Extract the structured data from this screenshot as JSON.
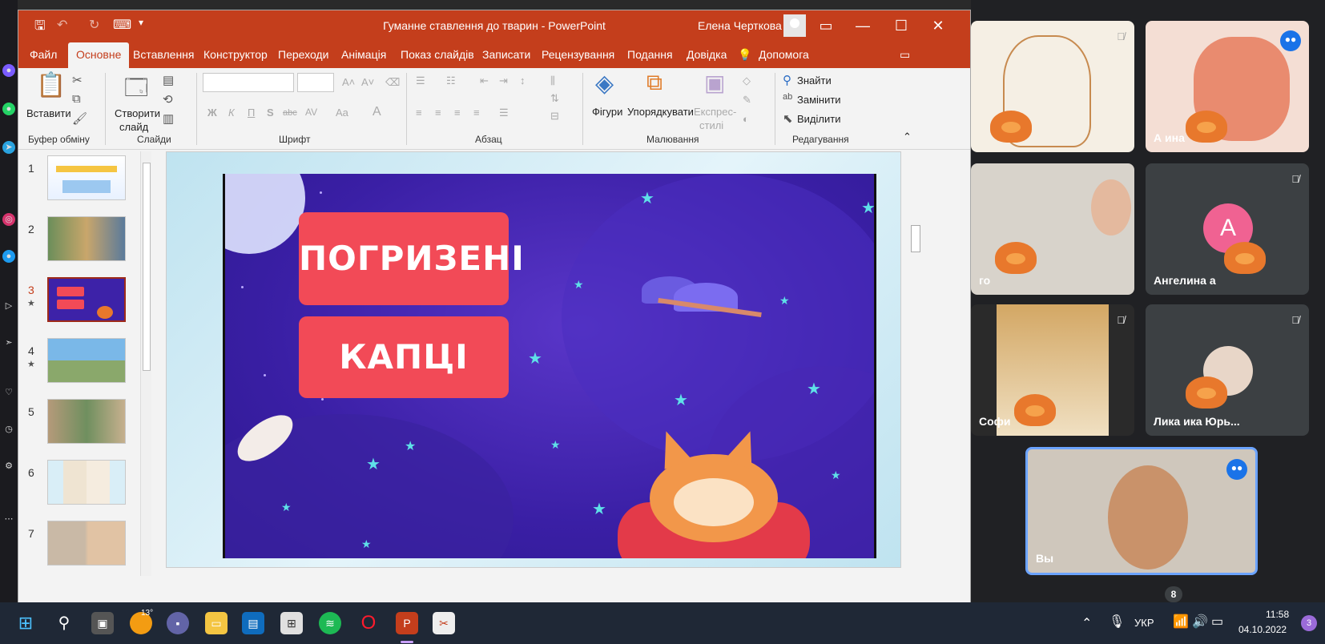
{
  "window": {
    "title": "Гуманне ставлення до тварин  -  PowerPoint",
    "user": "Елена Черткова"
  },
  "tabs": [
    "Файл",
    "Основне",
    "Вставлення",
    "Конструктор",
    "Переходи",
    "Анімація",
    "Показ слайдів",
    "Записати",
    "Рецензування",
    "Подання",
    "Довідка",
    "Допомога"
  ],
  "ribbon": {
    "paste": "Вставити",
    "create_slide_1": "Створити",
    "create_slide_2": "слайд",
    "figures": "Фігури",
    "arrange": "Упорядкувати",
    "styles_1": "Експрес-",
    "styles_2": "стилі",
    "find": "Знайти",
    "replace": "Замінити",
    "select": "Виділити",
    "groups": {
      "clipboard": "Буфер обміну",
      "slides": "Слайди",
      "font": "Шрифт",
      "paragraph": "Абзац",
      "drawing": "Малювання",
      "editing": "Редагування"
    },
    "font_buttons": [
      "Ж",
      "К",
      "П",
      "S",
      "abc",
      "AV",
      "Aa",
      "A"
    ]
  },
  "slides": [
    {
      "num": "1",
      "star": ""
    },
    {
      "num": "2",
      "star": ""
    },
    {
      "num": "3",
      "star": "★"
    },
    {
      "num": "4",
      "star": "★"
    },
    {
      "num": "5",
      "star": ""
    },
    {
      "num": "6",
      "star": ""
    },
    {
      "num": "7",
      "star": ""
    }
  ],
  "slide_content": {
    "line1": "ПОГРИЗЕНІ",
    "line2": "КАПЦІ"
  },
  "participants": [
    {
      "name": ""
    },
    {
      "name": "А         ина"
    },
    {
      "name": "го"
    },
    {
      "name": "Ангелина          а",
      "initial": "A"
    },
    {
      "name": "Софи"
    },
    {
      "name": "Лика          ика Юрь..."
    },
    {
      "name": "Вы"
    }
  ],
  "participant_count": "8",
  "taskbar": {
    "weather": "13°",
    "lang": "УКР",
    "time": "11:58",
    "date": "04.10.2022",
    "notifications": "3"
  }
}
